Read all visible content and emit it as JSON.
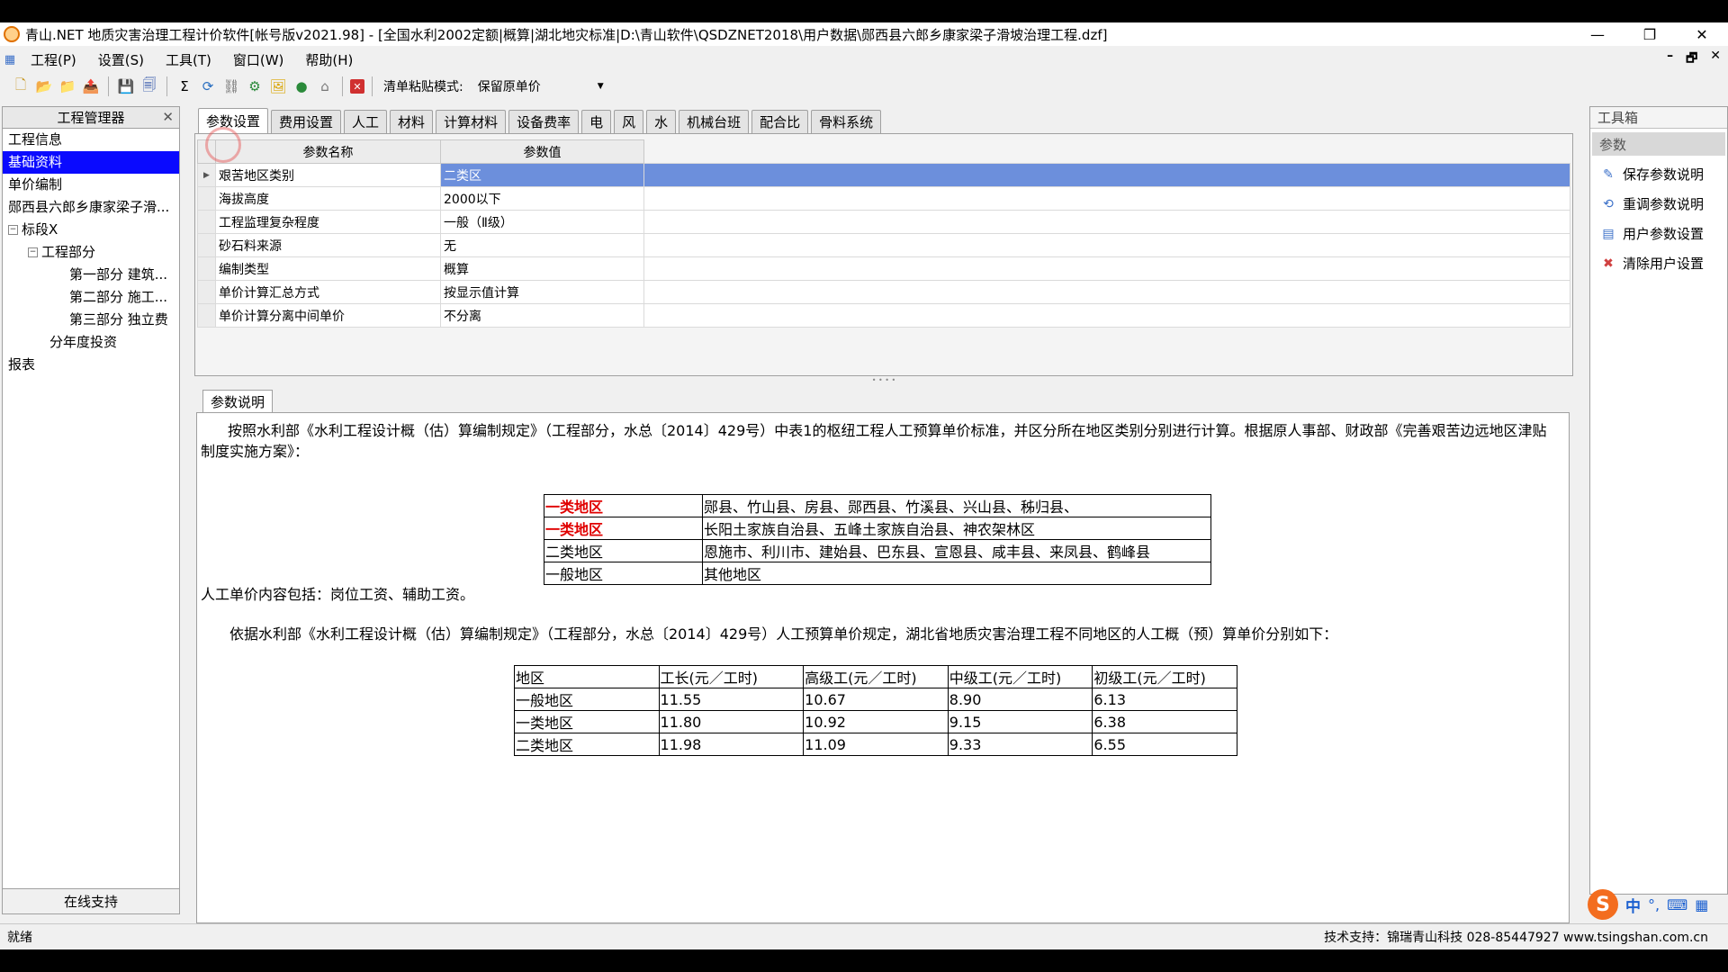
{
  "window": {
    "title": "青山.NET 地质灾害治理工程计价软件[帐号版v2021.98] - [全国水利2002定额|概算|湖北地灾标准|D:\\青山软件\\QSDZNET2018\\用户数据\\郧西县六郎乡康家梁子滑坡治理工程.dzf]",
    "minimize": "—",
    "restore": "❐",
    "close": "✕",
    "mdi_min": "–",
    "mdi_restore": "🗗",
    "mdi_close": "✕"
  },
  "menu": [
    "工程(P)",
    "设置(S)",
    "工具(T)",
    "窗口(W)",
    "帮助(H)"
  ],
  "toolbar": {
    "paste_mode_label": "清单粘贴模式:",
    "paste_mode_value": "保留原单价"
  },
  "project_manager": {
    "title": "工程管理器",
    "items": [
      {
        "label": "工程信息"
      },
      {
        "label": "基础资料",
        "selected": true
      },
      {
        "label": "单价编制"
      },
      {
        "label": "郧西县六郎乡康家梁子滑..."
      },
      {
        "label": "标段X"
      },
      {
        "label": "工程部分"
      },
      {
        "label": "第一部分 建筑..."
      },
      {
        "label": "第二部分 施工..."
      },
      {
        "label": "第三部分 独立费"
      },
      {
        "label": "分年度投资"
      },
      {
        "label": "报表"
      }
    ],
    "online_support": "在线支持"
  },
  "tabs": [
    "参数设置",
    "费用设置",
    "人工",
    "材料",
    "计算材料",
    "设备费率",
    "电",
    "风",
    "水",
    "机械台班",
    "配合比",
    "骨料系统"
  ],
  "param_grid": {
    "headers": [
      "参数名称",
      "参数值"
    ],
    "rows": [
      {
        "name": "艰苦地区类别",
        "value": "二类区",
        "selected": true
      },
      {
        "name": "海拔高度",
        "value": "2000以下"
      },
      {
        "name": "工程监理复杂程度",
        "value": "一般（Ⅱ级）"
      },
      {
        "name": "砂石料来源",
        "value": "无"
      },
      {
        "name": "编制类型",
        "value": "概算"
      },
      {
        "name": "单价计算汇总方式",
        "value": "按显示值计算"
      },
      {
        "name": "单价计算分离中间单价",
        "value": "不分离"
      }
    ]
  },
  "description": {
    "tab": "参数说明",
    "p1": "按照水利部《水利工程设计概（估）算编制规定》（工程部分，水总〔2014〕429号）中表1的枢纽工程人工预算单价标准，并区分所在地区类别分别进行计算。根据原人事部、财政部《完善艰苦边远地区津贴制度实施方案》：",
    "regions": [
      {
        "cat": "一类地区",
        "areas": "郧县、竹山县、房县、郧西县、竹溪县、兴山县、秭归县、",
        "red": true
      },
      {
        "cat": "一类地区",
        "areas": "长阳土家族自治县、五峰土家族自治县、神农架林区",
        "red": true
      },
      {
        "cat": "二类地区",
        "areas": "恩施市、利川市、建始县、巴东县、宣恩县、咸丰县、来凤县、鹤峰县",
        "red": false
      },
      {
        "cat": "一般地区",
        "areas": "其他地区",
        "red": false
      }
    ],
    "p2": "人工单价内容包括：岗位工资、辅助工资。",
    "p3": "依据水利部《水利工程设计概（估）算编制规定》（工程部分，水总〔2014〕429号）人工预算单价规定，湖北省地质灾害治理工程不同地区的人工概（预）算单价分别如下：",
    "wage_headers": [
      "地区",
      "工长(元／工时)",
      "高级工(元／工时)",
      "中级工(元／工时)",
      "初级工(元／工时)"
    ],
    "wage_rows": [
      [
        "一般地区",
        "11.55",
        "10.67",
        "8.90",
        "6.13"
      ],
      [
        "一类地区",
        "11.80",
        "10.92",
        "9.15",
        "6.38"
      ],
      [
        "二类地区",
        "11.98",
        "11.09",
        "9.33",
        "6.55"
      ]
    ]
  },
  "toolbox": {
    "title": "工具箱",
    "section": "参数",
    "items": [
      "保存参数说明",
      "重调参数说明",
      "用户参数设置",
      "清除用户设置"
    ]
  },
  "status": {
    "left": "就绪",
    "support": "技术支持：锦瑞青山科技 028-85447927 www.tsingshan.com.cn"
  },
  "ime": {
    "s": "S",
    "zh": "中",
    "punct": "°,",
    "kb": "⌨",
    "grid": "▦"
  }
}
